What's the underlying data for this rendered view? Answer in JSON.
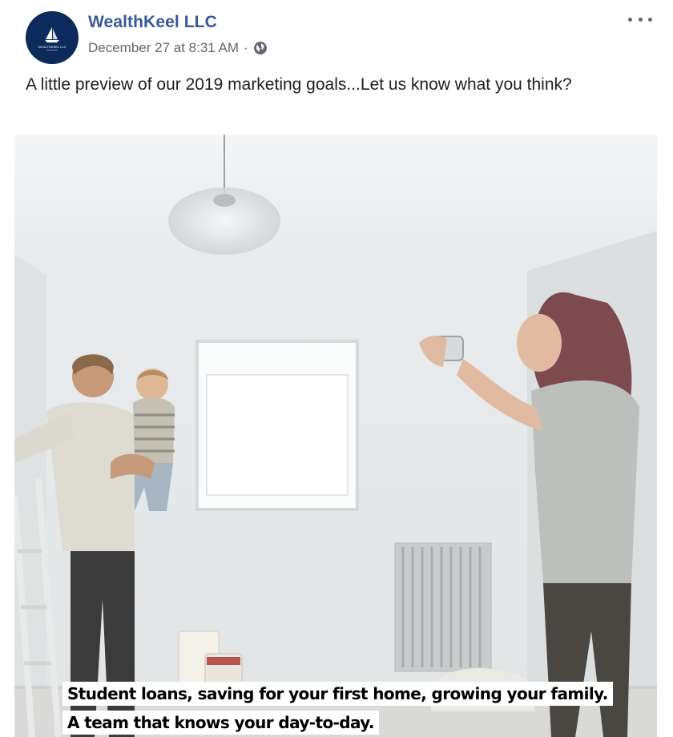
{
  "post": {
    "author": "WealthKeel LLC",
    "avatar_text": "WEALTHKEEL LLC",
    "timestamp": "December 27 at 8:31 AM",
    "separator": "·",
    "privacy_icon": "globe-icon",
    "more_icon": "more-options-icon",
    "caption": "A little preview of our 2019 marketing goals...Let us know what you think?",
    "video": {
      "subtitle_line1": "Student loans, saving for your first home, growing your family.",
      "subtitle_line2": "A team that knows your day-to-day."
    }
  },
  "colors": {
    "author_link": "#385898",
    "meta_text": "#606770",
    "avatar_bg": "#0d2a5c"
  }
}
